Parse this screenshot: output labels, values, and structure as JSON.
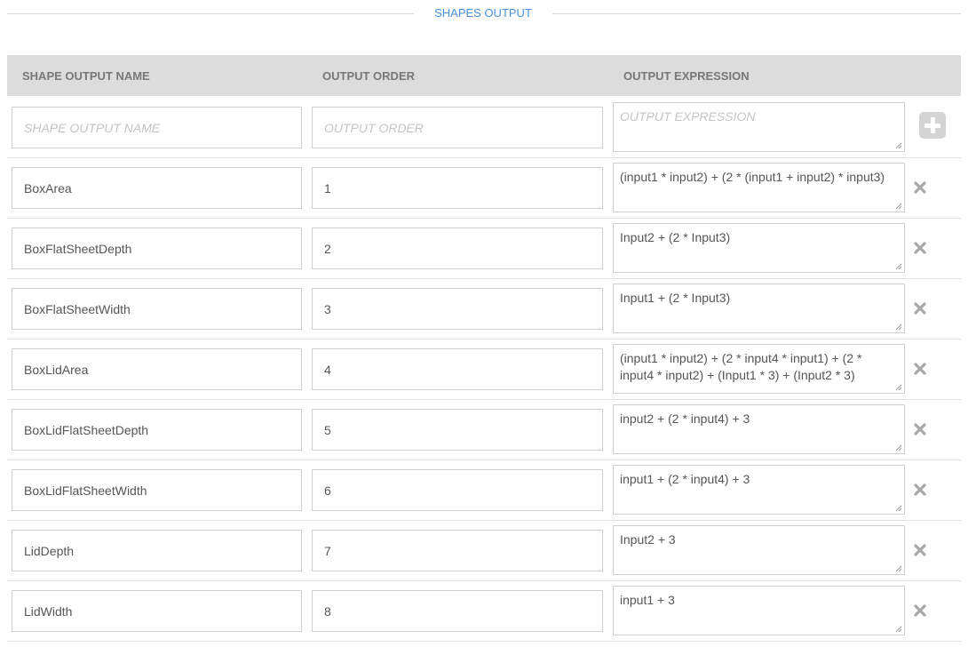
{
  "section": {
    "title": "SHAPES OUTPUT"
  },
  "table": {
    "headers": {
      "name": "SHAPE OUTPUT NAME",
      "order": "OUTPUT ORDER",
      "expression": "OUTPUT EXPRESSION"
    },
    "new_row": {
      "name_placeholder": "SHAPE OUTPUT NAME",
      "order_placeholder": "OUTPUT ORDER",
      "expression_placeholder": "OUTPUT EXPRESSION",
      "add_icon": "plus-square-icon"
    },
    "rows": [
      {
        "name": "BoxArea",
        "order": "1",
        "expression": "(input1 * input2) + (2 * (input1 + input2) * input3)"
      },
      {
        "name": "BoxFlatSheetDepth",
        "order": "2",
        "expression": "Input2 + (2 * Input3)"
      },
      {
        "name": "BoxFlatSheetWidth",
        "order": "3",
        "expression": "Input1 + (2 * Input3)"
      },
      {
        "name": "BoxLidArea",
        "order": "4",
        "expression": "(input1 * input2) + (2 * input4 * input1) + (2 * input4 * input2) +  (Input1 * 3) + (Input2 * 3)"
      },
      {
        "name": "BoxLidFlatSheetDepth",
        "order": "5",
        "expression": "input2 + (2 * input4) + 3"
      },
      {
        "name": "BoxLidFlatSheetWidth",
        "order": "6",
        "expression": "input1 + (2 * input4) + 3"
      },
      {
        "name": "LidDepth",
        "order": "7",
        "expression": "Input2 + 3"
      },
      {
        "name": "LidWidth",
        "order": "8",
        "expression": "input1 + 3"
      }
    ],
    "delete_icon": "close-icon"
  },
  "colors": {
    "accent": "#4a90d9",
    "header_bg": "#dcdcdc",
    "border": "#cfcfcf",
    "placeholder": "#c4c4c4",
    "icon": "#a8a8a8"
  }
}
